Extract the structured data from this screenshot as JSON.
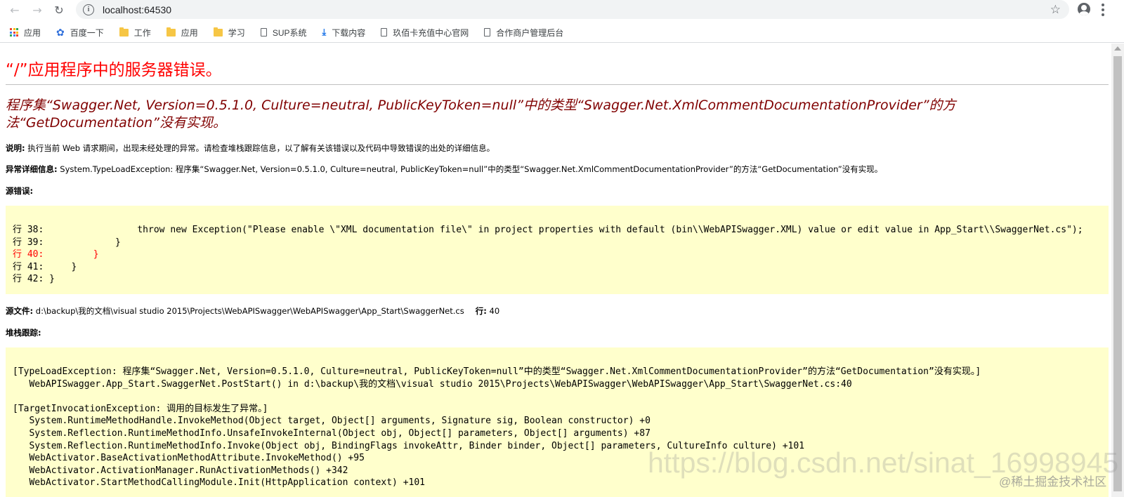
{
  "browser": {
    "url": "localhost:64530"
  },
  "bookmarks": [
    {
      "label": "应用",
      "icon": "apps-grid-icon"
    },
    {
      "label": "百度一下",
      "icon": "baidu-paw-icon"
    },
    {
      "label": "工作",
      "icon": "folder-icon"
    },
    {
      "label": "应用",
      "icon": "folder-icon"
    },
    {
      "label": "学习",
      "icon": "folder-icon"
    },
    {
      "label": "SUP系统",
      "icon": "page-icon"
    },
    {
      "label": "下载内容",
      "icon": "download-icon"
    },
    {
      "label": "玖佰卡充值中心官网",
      "icon": "page-icon"
    },
    {
      "label": "合作商户管理后台",
      "icon": "page-icon"
    }
  ],
  "page": {
    "title": "“/”应用程序中的服务器错误。",
    "error_heading": "程序集“Swagger.Net, Version=0.5.1.0, Culture=neutral, PublicKeyToken=null”中的类型“Swagger.Net.XmlCommentDocumentationProvider”的方法“GetDocumentation”没有实现。",
    "description_label": "说明:",
    "description_text": " 执行当前 Web 请求期间，出现未经处理的异常。请检查堆栈跟踪信息，以了解有关该错误以及代码中导致错误的出处的详细信息。",
    "exception_label": "异常详细信息:",
    "exception_text": " System.TypeLoadException: 程序集“Swagger.Net, Version=0.5.1.0, Culture=neutral, PublicKeyToken=null”中的类型“Swagger.Net.XmlCommentDocumentationProvider”的方法“GetDocumentation”没有实现。",
    "source_error_label": "源错误:",
    "source_lines": [
      {
        "text": "行 38:                 throw new Exception(\"Please enable \\\"XML documentation file\\\" in project properties with default (bin\\\\WebAPISwagger.XML) value or edit value in App_Start\\\\SwaggerNet.cs\");",
        "highlight": false
      },
      {
        "text": "行 39:             }",
        "highlight": false
      },
      {
        "text": "行 40:         }",
        "highlight": true
      },
      {
        "text": "行 41:     }",
        "highlight": false
      },
      {
        "text": "行 42: }",
        "highlight": false
      }
    ],
    "source_file_label": "源文件:",
    "source_file_path": " d:\\backup\\我的文档\\visual studio 2015\\Projects\\WebAPISwagger\\WebAPISwagger\\App_Start\\SwaggerNet.cs",
    "line_label": "行:",
    "line_number": " 40",
    "stack_trace_label": "堆栈跟踪:",
    "stack_lines": [
      "[TypeLoadException: 程序集“Swagger.Net, Version=0.5.1.0, Culture=neutral, PublicKeyToken=null”中的类型“Swagger.Net.XmlCommentDocumentationProvider”的方法“GetDocumentation”没有实现。]",
      "   WebAPISwagger.App_Start.SwaggerNet.PostStart() in d:\\backup\\我的文档\\visual studio 2015\\Projects\\WebAPISwagger\\WebAPISwagger\\App_Start\\SwaggerNet.cs:40",
      "",
      "[TargetInvocationException: 调用的目标发生了异常。]",
      "   System.RuntimeMethodHandle.InvokeMethod(Object target, Object[] arguments, Signature sig, Boolean constructor) +0",
      "   System.Reflection.RuntimeMethodInfo.UnsafeInvokeInternal(Object obj, Object[] parameters, Object[] arguments) +87",
      "   System.Reflection.RuntimeMethodInfo.Invoke(Object obj, BindingFlags invokeAttr, Binder binder, Object[] parameters, CultureInfo culture) +101",
      "   WebActivator.BaseActivationMethodAttribute.InvokeMethod() +95",
      "   WebActivator.ActivationManager.RunActivationMethods() +342",
      "   WebActivator.StartMethodCallingModule.Init(HttpApplication context) +101"
    ]
  },
  "watermark": {
    "main": "https://blog.csdn.net/sinat_16998945",
    "secondary": "@稀土掘金技术社区"
  },
  "colors": {
    "title_red": "#ff0000",
    "heading_maroon": "#800000",
    "code_background": "#ffffcc"
  }
}
